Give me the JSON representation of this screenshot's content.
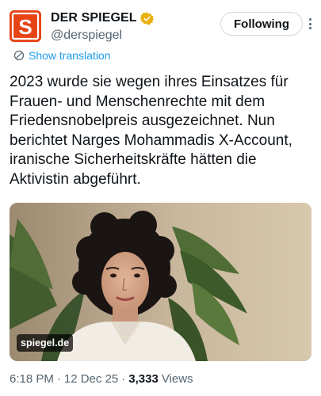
{
  "author": {
    "display_name": "DER SPIEGEL",
    "handle": "@derspiegel",
    "avatar_letter": "S",
    "avatar_color": "#e64415",
    "verified_color": "#e8b10e"
  },
  "actions": {
    "follow_label": "Following"
  },
  "translation": {
    "label": "Show translation"
  },
  "tweet": {
    "lines": [
      "2023 wurde sie wegen ihres Einsatzes für",
      "Frauen- und Menschenrechte mit dem",
      "Friedensnobelpreis ausgezeichnet. Nun",
      "berichtet Narges Mohammadis X-Account,",
      "iranische Sicherheitskräfte hätten die",
      "Aktivistin abgeführt."
    ]
  },
  "media": {
    "watermark": "spiegel.de"
  },
  "meta": {
    "time": "6:18 PM",
    "separator": "·",
    "date": "12 Dec 25",
    "views_count": "3,333",
    "views_label": "Views"
  },
  "colors": {
    "link": "#1d9bf0",
    "secondary_text": "#536471",
    "primary_text": "#0f1419"
  }
}
